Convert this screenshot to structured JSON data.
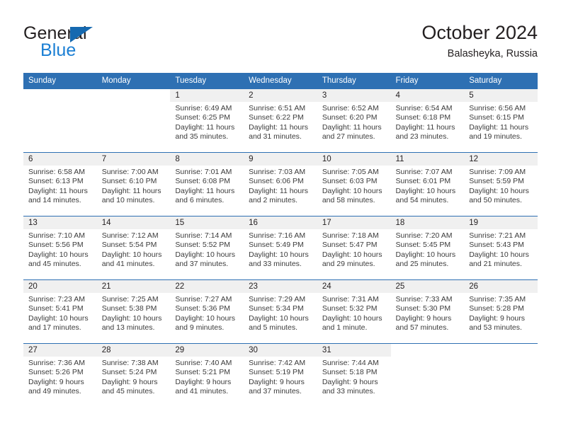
{
  "brand": {
    "word_one": "General",
    "word_two": "Blue",
    "triangle_color": "#1569b0",
    "blue_color": "#1b7fd4"
  },
  "header": {
    "title": "October 2024",
    "subtitle": "Balasheyka, Russia"
  },
  "theme": {
    "header_blue": "#2e70b3",
    "day_band_gray": "#f0f0f0",
    "text_color": "#231f20"
  },
  "weekdays": [
    "Sunday",
    "Monday",
    "Tuesday",
    "Wednesday",
    "Thursday",
    "Friday",
    "Saturday"
  ],
  "labels": {
    "sunrise_prefix": "Sunrise:",
    "sunset_prefix": "Sunset:",
    "daylight_prefix": "Daylight:"
  },
  "weeks": [
    [
      {
        "day": "",
        "blank": true
      },
      {
        "day": "",
        "blank": true
      },
      {
        "day": "1",
        "sunrise": "Sunrise: 6:49 AM",
        "sunset": "Sunset: 6:25 PM",
        "daylight": "Daylight: 11 hours and 35 minutes."
      },
      {
        "day": "2",
        "sunrise": "Sunrise: 6:51 AM",
        "sunset": "Sunset: 6:22 PM",
        "daylight": "Daylight: 11 hours and 31 minutes."
      },
      {
        "day": "3",
        "sunrise": "Sunrise: 6:52 AM",
        "sunset": "Sunset: 6:20 PM",
        "daylight": "Daylight: 11 hours and 27 minutes."
      },
      {
        "day": "4",
        "sunrise": "Sunrise: 6:54 AM",
        "sunset": "Sunset: 6:18 PM",
        "daylight": "Daylight: 11 hours and 23 minutes."
      },
      {
        "day": "5",
        "sunrise": "Sunrise: 6:56 AM",
        "sunset": "Sunset: 6:15 PM",
        "daylight": "Daylight: 11 hours and 19 minutes."
      }
    ],
    [
      {
        "day": "6",
        "sunrise": "Sunrise: 6:58 AM",
        "sunset": "Sunset: 6:13 PM",
        "daylight": "Daylight: 11 hours and 14 minutes."
      },
      {
        "day": "7",
        "sunrise": "Sunrise: 7:00 AM",
        "sunset": "Sunset: 6:10 PM",
        "daylight": "Daylight: 11 hours and 10 minutes."
      },
      {
        "day": "8",
        "sunrise": "Sunrise: 7:01 AM",
        "sunset": "Sunset: 6:08 PM",
        "daylight": "Daylight: 11 hours and 6 minutes."
      },
      {
        "day": "9",
        "sunrise": "Sunrise: 7:03 AM",
        "sunset": "Sunset: 6:06 PM",
        "daylight": "Daylight: 11 hours and 2 minutes."
      },
      {
        "day": "10",
        "sunrise": "Sunrise: 7:05 AM",
        "sunset": "Sunset: 6:03 PM",
        "daylight": "Daylight: 10 hours and 58 minutes."
      },
      {
        "day": "11",
        "sunrise": "Sunrise: 7:07 AM",
        "sunset": "Sunset: 6:01 PM",
        "daylight": "Daylight: 10 hours and 54 minutes."
      },
      {
        "day": "12",
        "sunrise": "Sunrise: 7:09 AM",
        "sunset": "Sunset: 5:59 PM",
        "daylight": "Daylight: 10 hours and 50 minutes."
      }
    ],
    [
      {
        "day": "13",
        "sunrise": "Sunrise: 7:10 AM",
        "sunset": "Sunset: 5:56 PM",
        "daylight": "Daylight: 10 hours and 45 minutes."
      },
      {
        "day": "14",
        "sunrise": "Sunrise: 7:12 AM",
        "sunset": "Sunset: 5:54 PM",
        "daylight": "Daylight: 10 hours and 41 minutes."
      },
      {
        "day": "15",
        "sunrise": "Sunrise: 7:14 AM",
        "sunset": "Sunset: 5:52 PM",
        "daylight": "Daylight: 10 hours and 37 minutes."
      },
      {
        "day": "16",
        "sunrise": "Sunrise: 7:16 AM",
        "sunset": "Sunset: 5:49 PM",
        "daylight": "Daylight: 10 hours and 33 minutes."
      },
      {
        "day": "17",
        "sunrise": "Sunrise: 7:18 AM",
        "sunset": "Sunset: 5:47 PM",
        "daylight": "Daylight: 10 hours and 29 minutes."
      },
      {
        "day": "18",
        "sunrise": "Sunrise: 7:20 AM",
        "sunset": "Sunset: 5:45 PM",
        "daylight": "Daylight: 10 hours and 25 minutes."
      },
      {
        "day": "19",
        "sunrise": "Sunrise: 7:21 AM",
        "sunset": "Sunset: 5:43 PM",
        "daylight": "Daylight: 10 hours and 21 minutes."
      }
    ],
    [
      {
        "day": "20",
        "sunrise": "Sunrise: 7:23 AM",
        "sunset": "Sunset: 5:41 PM",
        "daylight": "Daylight: 10 hours and 17 minutes."
      },
      {
        "day": "21",
        "sunrise": "Sunrise: 7:25 AM",
        "sunset": "Sunset: 5:38 PM",
        "daylight": "Daylight: 10 hours and 13 minutes."
      },
      {
        "day": "22",
        "sunrise": "Sunrise: 7:27 AM",
        "sunset": "Sunset: 5:36 PM",
        "daylight": "Daylight: 10 hours and 9 minutes."
      },
      {
        "day": "23",
        "sunrise": "Sunrise: 7:29 AM",
        "sunset": "Sunset: 5:34 PM",
        "daylight": "Daylight: 10 hours and 5 minutes."
      },
      {
        "day": "24",
        "sunrise": "Sunrise: 7:31 AM",
        "sunset": "Sunset: 5:32 PM",
        "daylight": "Daylight: 10 hours and 1 minute."
      },
      {
        "day": "25",
        "sunrise": "Sunrise: 7:33 AM",
        "sunset": "Sunset: 5:30 PM",
        "daylight": "Daylight: 9 hours and 57 minutes."
      },
      {
        "day": "26",
        "sunrise": "Sunrise: 7:35 AM",
        "sunset": "Sunset: 5:28 PM",
        "daylight": "Daylight: 9 hours and 53 minutes."
      }
    ],
    [
      {
        "day": "27",
        "sunrise": "Sunrise: 7:36 AM",
        "sunset": "Sunset: 5:26 PM",
        "daylight": "Daylight: 9 hours and 49 minutes."
      },
      {
        "day": "28",
        "sunrise": "Sunrise: 7:38 AM",
        "sunset": "Sunset: 5:24 PM",
        "daylight": "Daylight: 9 hours and 45 minutes."
      },
      {
        "day": "29",
        "sunrise": "Sunrise: 7:40 AM",
        "sunset": "Sunset: 5:21 PM",
        "daylight": "Daylight: 9 hours and 41 minutes."
      },
      {
        "day": "30",
        "sunrise": "Sunrise: 7:42 AM",
        "sunset": "Sunset: 5:19 PM",
        "daylight": "Daylight: 9 hours and 37 minutes."
      },
      {
        "day": "31",
        "sunrise": "Sunrise: 7:44 AM",
        "sunset": "Sunset: 5:18 PM",
        "daylight": "Daylight: 9 hours and 33 minutes."
      },
      {
        "day": "",
        "blank": true
      },
      {
        "day": "",
        "blank": true
      }
    ]
  ]
}
